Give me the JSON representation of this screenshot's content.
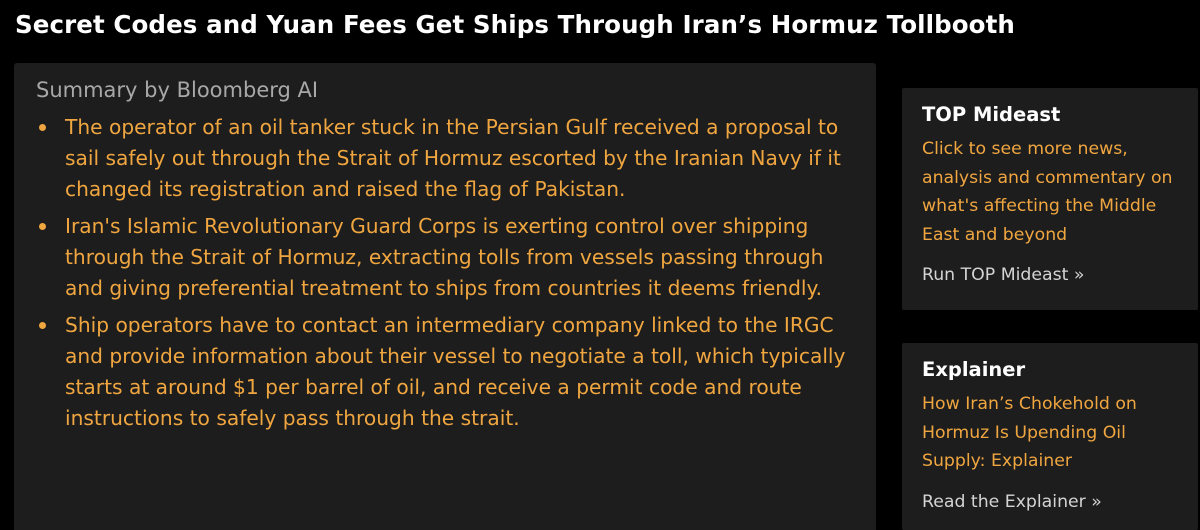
{
  "headline": "Secret Codes and Yuan Fees Get Ships Through Iran’s Hormuz Tollbooth",
  "summary": {
    "title": "Summary by Bloomberg AI",
    "bullets": [
      "The operator of an oil tanker stuck in the Persian Gulf received a proposal to sail safely out through the Strait of Hormuz escorted by the Iranian Navy if it changed its registration and raised the flag of Pakistan.",
      "Iran's Islamic Revolutionary Guard Corps is exerting control over shipping through the Strait of Hormuz, extracting tolls from vessels passing through and giving preferential treatment to ships from countries it deems friendly.",
      "Ship operators have to contact an intermediary company linked to the IRGC and provide information about their vessel to negotiate a toll, which typically starts at around $1 per barrel of oil, and receive a permit code and route instructions to safely pass through the strait."
    ]
  },
  "sidebar": {
    "top_mideast": {
      "title": "TOP Mideast",
      "description": "Click to see more news, analysis and commentary on what's affecting the Middle East and beyond",
      "cta": "Run TOP Mideast »"
    },
    "explainer": {
      "title": "Explainer",
      "link": "How Iran’s Chokehold on Hormuz Is Upending Oil Supply: Explainer",
      "cta": "Read the Explainer »"
    }
  },
  "colors": {
    "background": "#000000",
    "panel": "#1d1d1d",
    "accent": "#f0a640",
    "headline": "#ffffff",
    "muted": "#a8a8a8"
  }
}
